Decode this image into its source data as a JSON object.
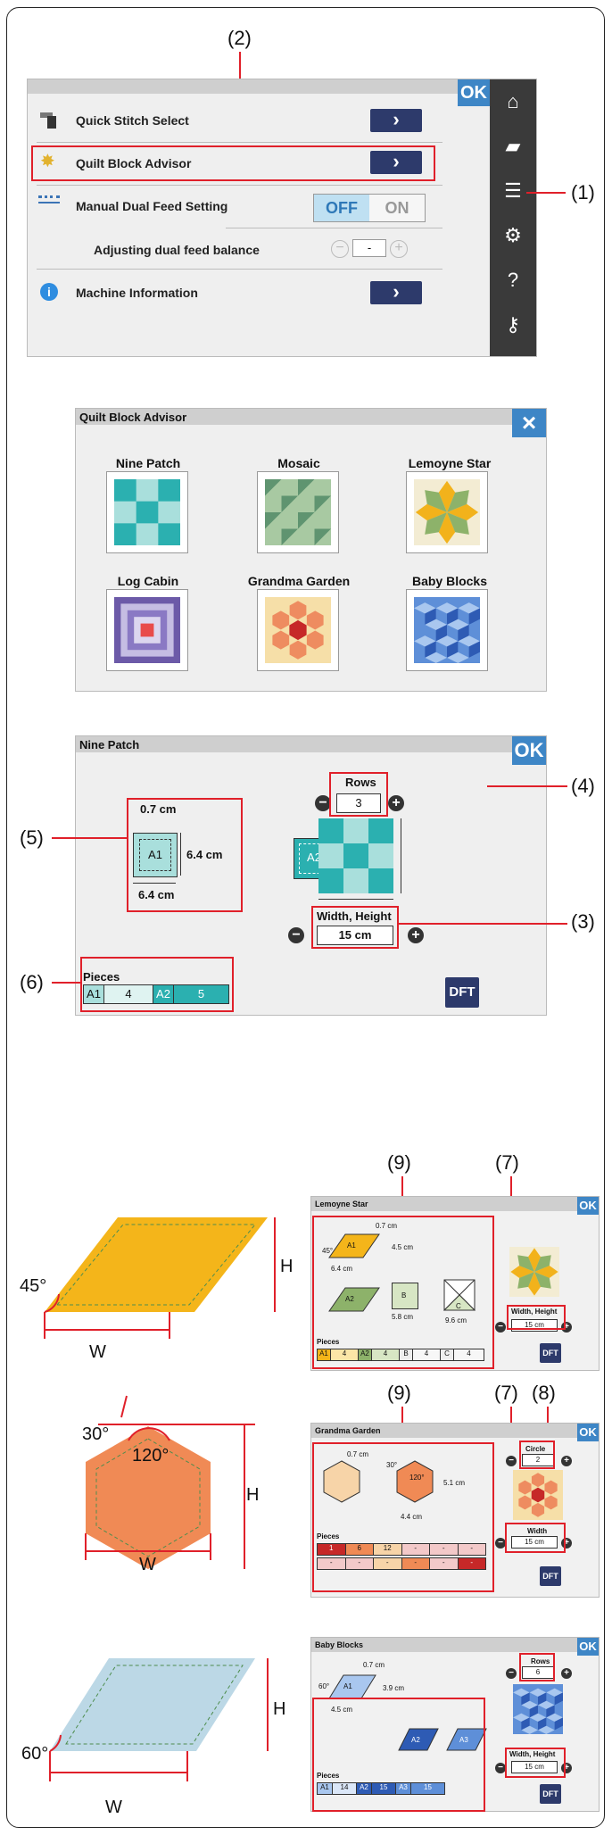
{
  "callouts": {
    "c1": "(1)",
    "c2": "(2)",
    "c3": "(3)",
    "c4": "(4)",
    "c5": "(5)",
    "c6": "(6)",
    "c7": "(7)",
    "c8": "(8)",
    "c9": "(9)"
  },
  "menu": {
    "ok": "OK",
    "items": [
      {
        "label": "Quick Stitch Select"
      },
      {
        "label": "Quilt Block Advisor"
      },
      {
        "label": "Manual Dual Feed Setting",
        "off": "OFF",
        "on": "ON"
      },
      {
        "label": "Adjusting dual feed balance",
        "value": "-"
      },
      {
        "label": "Machine Information"
      }
    ]
  },
  "advisor": {
    "title": "Quilt Block Advisor",
    "close": "×",
    "patterns": [
      "Nine Patch",
      "Mosaic",
      "Lemoyne Star",
      "Log Cabin",
      "Grandma Garden",
      "Baby Blocks"
    ]
  },
  "ninepatch": {
    "title": "Nine Patch",
    "ok": "OK",
    "seam": "0.7 cm",
    "side": "6.4 cm",
    "bottom": "6.4 cm",
    "a1": "A1",
    "a2": "A2",
    "rows_label": "Rows",
    "rows_value": "3",
    "wh_label": "Width, Height",
    "wh_value": "15 cm",
    "pieces_label": "Pieces",
    "pieces": [
      {
        "name": "A1",
        "count": "4"
      },
      {
        "name": "A2",
        "count": "5"
      }
    ],
    "dft": "DFT"
  },
  "diagrams": {
    "d45": {
      "angle": "45°",
      "w": "W",
      "h": "H"
    },
    "hex": {
      "a30": "30°",
      "a120": "120°",
      "w": "W",
      "h": "H"
    },
    "d60": {
      "angle": "60°",
      "w": "W",
      "h": "H"
    }
  },
  "lemoyne": {
    "title": "Lemoyne Star",
    "ok": "OK",
    "seam": "0.7 cm",
    "h": "4.5 cm",
    "angle": "45°",
    "w": "6.4 cm",
    "a1": "A1",
    "a2": "A2",
    "b": "B",
    "b_w": "5.8 cm",
    "c": "C",
    "c_w": "9.6 cm",
    "wh_label": "Width, Height",
    "wh_value": "15 cm",
    "dft": "DFT",
    "pieces_label": "Pieces",
    "pieces": [
      {
        "name": "A1",
        "count": "4"
      },
      {
        "name": "A2",
        "count": "4"
      },
      {
        "name": "B",
        "count": "4"
      },
      {
        "name": "C",
        "count": "4"
      }
    ]
  },
  "grandma": {
    "title": "Grandma Garden",
    "ok": "OK",
    "seam": "0.7 cm",
    "a30": "30°",
    "a120": "120°",
    "h": "5.1 cm",
    "w": "4.4 cm",
    "circle_label": "Circle",
    "circle_value": "2",
    "width_label": "Width",
    "width_value": "15 cm",
    "dft": "DFT",
    "pieces_label": "Pieces",
    "pieces_row1": [
      "1",
      "6",
      "12",
      "-",
      "-",
      "-"
    ],
    "pieces_row2": [
      "-",
      "-",
      "-",
      "-",
      "-",
      "-"
    ]
  },
  "baby": {
    "title": "Baby Blocks",
    "ok": "OK",
    "seam": "0.7 cm",
    "angle": "60°",
    "h": "3.9 cm",
    "w": "4.5 cm",
    "a1": "A1",
    "a2": "A2",
    "a3": "A3",
    "rows_label": "Rows",
    "rows_value": "6",
    "wh_label": "Width, Height",
    "wh_value": "15 cm",
    "dft": "DFT",
    "pieces_label": "Pieces",
    "pieces": [
      {
        "name": "A1",
        "count": "14"
      },
      {
        "name": "A2",
        "count": "15"
      },
      {
        "name": "A3",
        "count": "15"
      }
    ]
  }
}
